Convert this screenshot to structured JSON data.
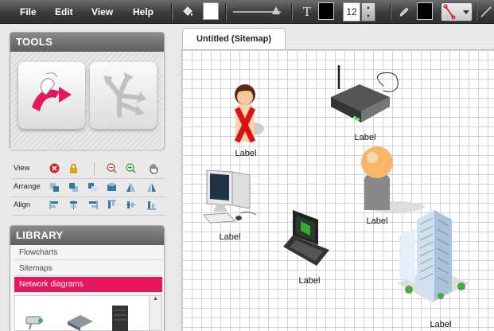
{
  "menu": {
    "file": "File",
    "edit": "Edit",
    "view": "View",
    "help": "Help"
  },
  "toolbar": {
    "font_size": "12",
    "fill_color": "#ffffff",
    "text_color": "#000000",
    "line_color": "#000000"
  },
  "tools": {
    "title": "TOOLS"
  },
  "rows": {
    "view": "View",
    "arrange": "Arrange",
    "align": "Align"
  },
  "library": {
    "title": "LIBRARY",
    "items": [
      {
        "label": "Flowcharts"
      },
      {
        "label": "Sitemaps"
      },
      {
        "label": "Network diagrams"
      }
    ]
  },
  "document": {
    "tab_title": "Untitled (Sitemap)"
  },
  "shapes": [
    {
      "label": "Label",
      "icon": "person-female-icon"
    },
    {
      "label": "Label",
      "icon": "router-icon"
    },
    {
      "label": "Label",
      "icon": "desktop-computer-icon"
    },
    {
      "label": "Label",
      "icon": "person-generic-icon"
    },
    {
      "label": "Label",
      "icon": "laptop-icon"
    },
    {
      "label": "Label",
      "icon": "office-building-icon"
    }
  ],
  "colors": {
    "accent": "#e8175d",
    "toolbar": "#3c3c3c"
  }
}
